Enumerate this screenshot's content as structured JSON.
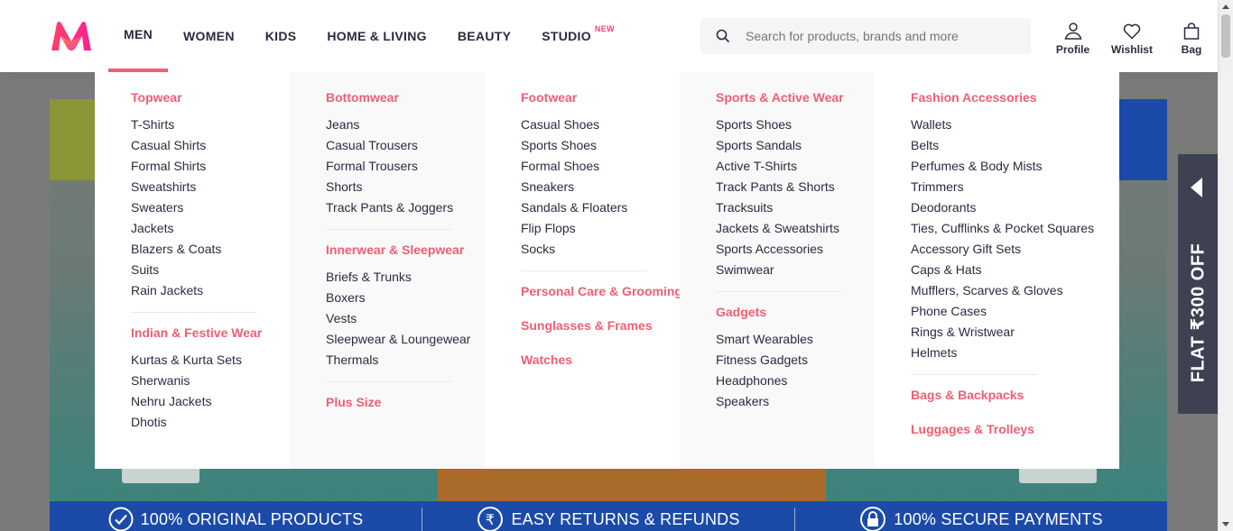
{
  "brand": {
    "logo_icon": "myntra-logo",
    "colors": {
      "accent": "#ee5f73",
      "nav_active": "#ee5f73",
      "trust_bg": "#1b4aa8"
    }
  },
  "nav": [
    {
      "label": "MEN",
      "active": true
    },
    {
      "label": "WOMEN"
    },
    {
      "label": "KIDS"
    },
    {
      "label": "HOME & LIVING"
    },
    {
      "label": "BEAUTY"
    },
    {
      "label": "STUDIO",
      "badge": "NEW"
    }
  ],
  "search": {
    "placeholder": "Search for products, brands and more",
    "icon": "search-icon"
  },
  "actions": [
    {
      "label": "Profile",
      "icon": "profile-icon"
    },
    {
      "label": "Wishlist",
      "icon": "heart-icon"
    },
    {
      "label": "Bag",
      "icon": "bag-icon"
    }
  ],
  "menu": {
    "col1": {
      "topwear": {
        "title": "Topwear",
        "items": [
          "T-Shirts",
          "Casual Shirts",
          "Formal Shirts",
          "Sweatshirts",
          "Sweaters",
          "Jackets",
          "Blazers & Coats",
          "Suits",
          "Rain Jackets"
        ]
      },
      "festive": {
        "title": "Indian & Festive Wear",
        "items": [
          "Kurtas & Kurta Sets",
          "Sherwanis",
          "Nehru Jackets",
          "Dhotis"
        ]
      }
    },
    "col2": {
      "bottomwear": {
        "title": "Bottomwear",
        "items": [
          "Jeans",
          "Casual Trousers",
          "Formal Trousers",
          "Shorts",
          "Track Pants & Joggers"
        ]
      },
      "innerwear": {
        "title": "Innerwear & Sleepwear",
        "items": [
          "Briefs & Trunks",
          "Boxers",
          "Vests",
          "Sleepwear & Loungewear",
          "Thermals"
        ]
      },
      "plus": {
        "title": "Plus Size"
      }
    },
    "col3": {
      "footwear": {
        "title": "Footwear",
        "items": [
          "Casual Shoes",
          "Sports Shoes",
          "Formal Shoes",
          "Sneakers",
          "Sandals & Floaters",
          "Flip Flops",
          "Socks"
        ]
      },
      "grooming": {
        "title": "Personal Care & Grooming"
      },
      "sunglasses": {
        "title": "Sunglasses & Frames"
      },
      "watches": {
        "title": "Watches"
      }
    },
    "col4": {
      "sports": {
        "title": "Sports & Active Wear",
        "items": [
          "Sports Shoes",
          "Sports Sandals",
          "Active T-Shirts",
          "Track Pants & Shorts",
          "Tracksuits",
          "Jackets & Sweatshirts",
          "Sports Accessories",
          "Swimwear"
        ]
      },
      "gadgets": {
        "title": "Gadgets",
        "items": [
          "Smart Wearables",
          "Fitness Gadgets",
          "Headphones",
          "Speakers"
        ]
      }
    },
    "col5": {
      "accessories": {
        "title": "Fashion Accessories",
        "items": [
          "Wallets",
          "Belts",
          "Perfumes & Body Mists",
          "Trimmers",
          "Deodorants",
          "Ties, Cufflinks & Pocket Squares",
          "Accessory Gift Sets",
          "Caps & Hats",
          "Mufflers, Scarves & Gloves",
          "Phone Cases",
          "Rings & Wristwear",
          "Helmets"
        ]
      },
      "bags": {
        "title": "Bags & Backpacks"
      },
      "luggage": {
        "title": "Luggages & Trolleys"
      }
    }
  },
  "trust_bar": [
    {
      "label": "100% ORIGINAL PRODUCTS",
      "icon": "check-circle-icon"
    },
    {
      "label": "EASY RETURNS & REFUNDS",
      "icon": "rupee-circle-icon"
    },
    {
      "label": "100% SECURE PAYMENTS",
      "icon": "lock-icon"
    }
  ],
  "side_tab": {
    "label": "FLAT ₹300 OFF",
    "icon": "arrow-left-icon"
  }
}
